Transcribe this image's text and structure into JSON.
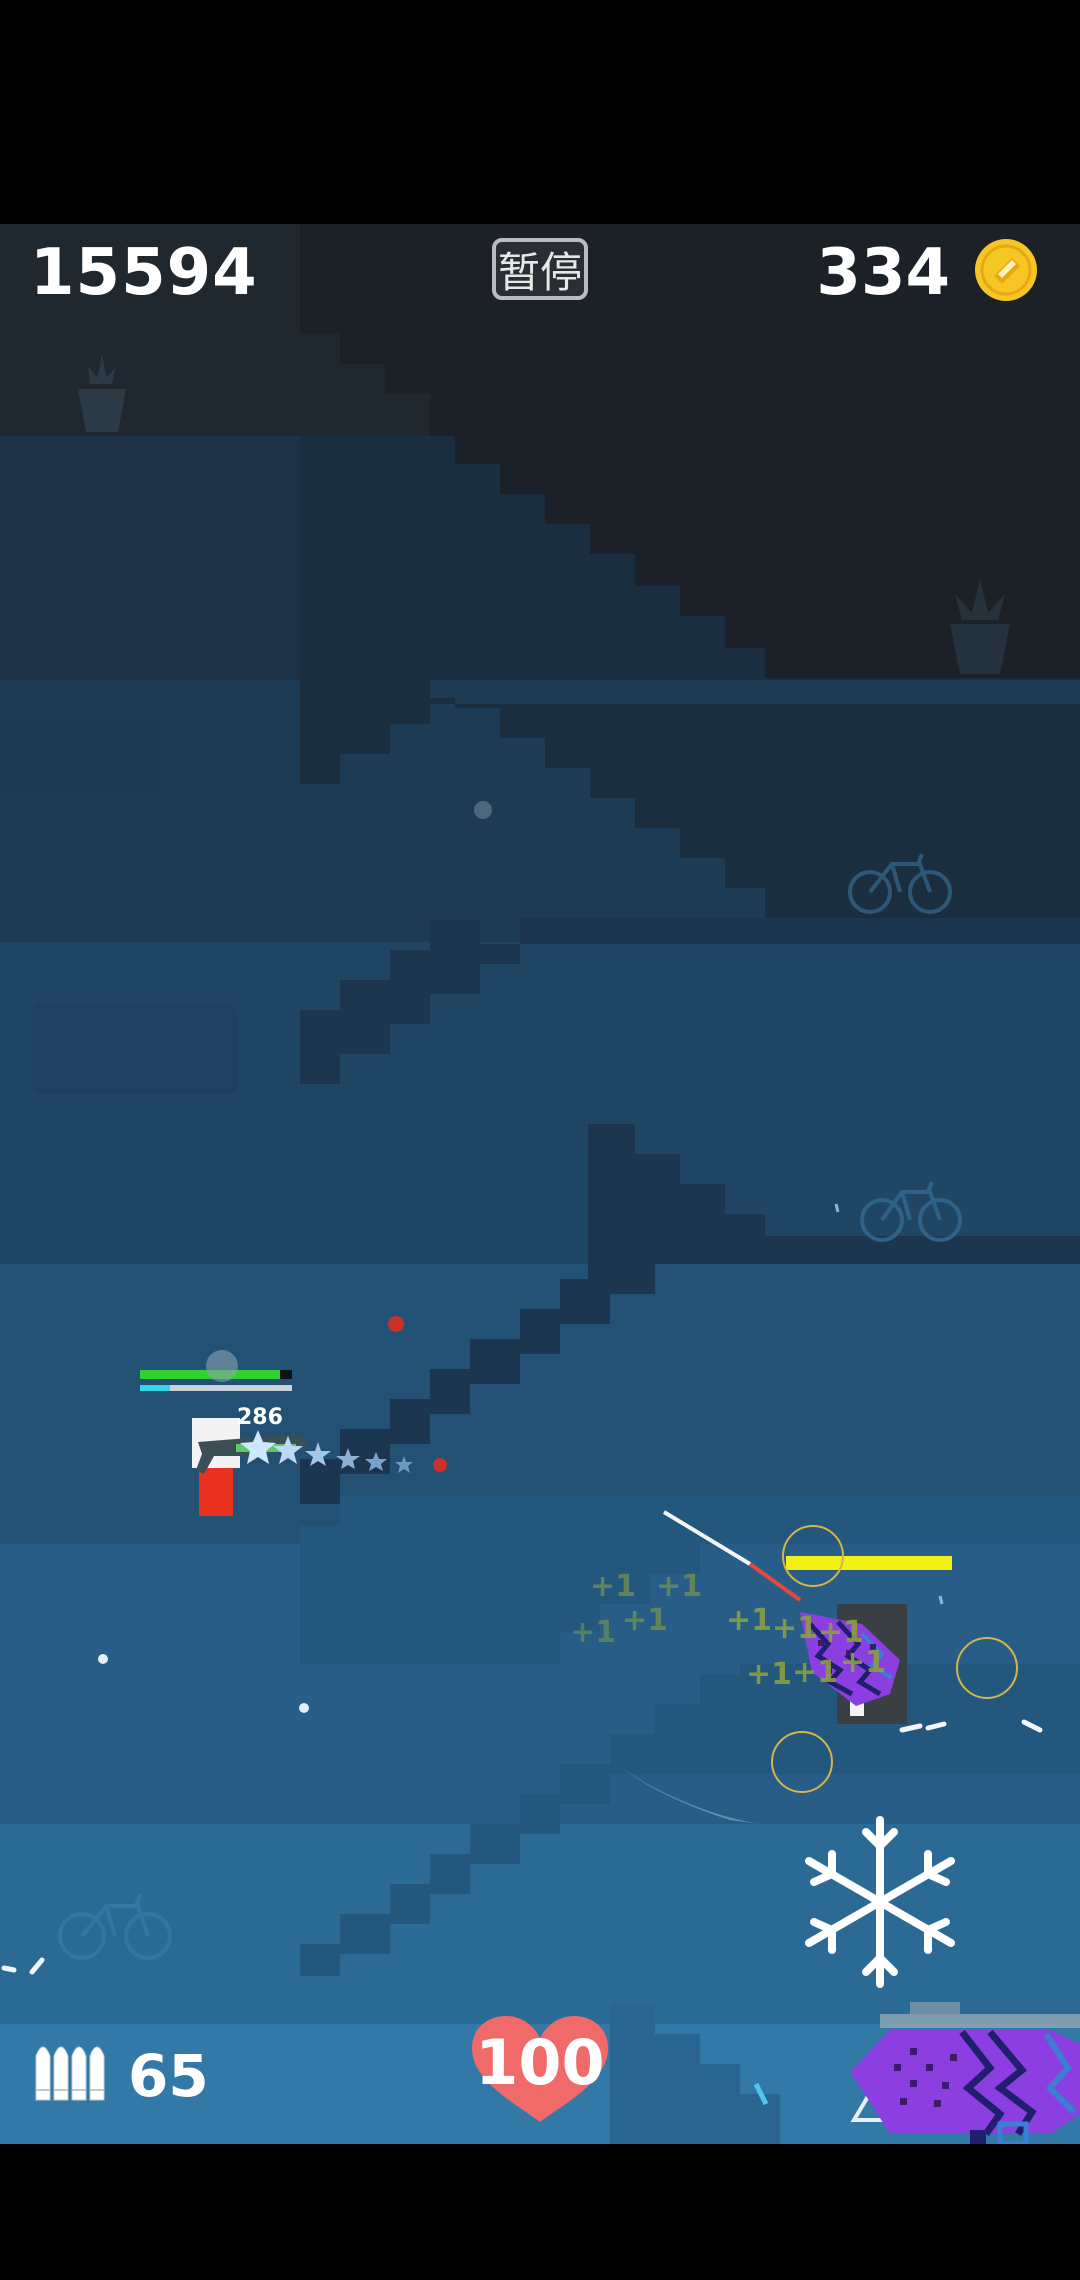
{
  "hud": {
    "score": "15594",
    "pause_label": "暂停",
    "coins": "334",
    "ammo": "65",
    "health": "100"
  },
  "player": {
    "damage_popup": "286",
    "health_bar_fill": 0.92
  },
  "enemy": {
    "health_bar_fill": 1.0,
    "hit_popups": [
      "+1",
      "+1",
      "+1",
      "+1",
      "+1",
      "+1",
      "+1",
      "+1",
      "+1",
      "+1"
    ]
  },
  "colors": {
    "health_heart": "#f06a6a",
    "coin": "#f6c624",
    "player_hp": "#2ed12e",
    "player_shield": "#35d6e8",
    "enemy_hp": "#f3f016",
    "enemy_body": "#8c3fe0"
  },
  "icons": {
    "coin": "coin-icon",
    "ammo": "bullets-icon",
    "health": "heart-icon",
    "snowflake": "snowflake-icon",
    "triangle": "triangle-button-icon"
  }
}
